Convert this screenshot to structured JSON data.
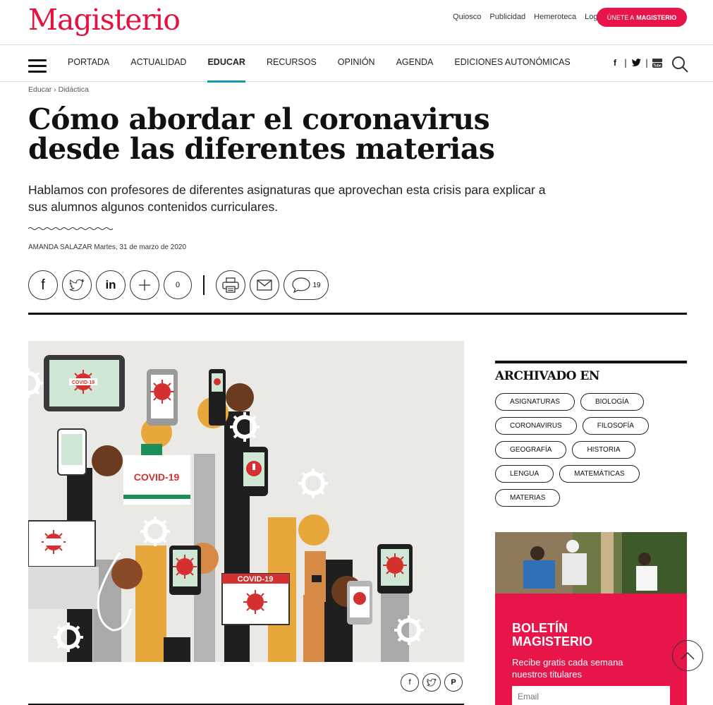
{
  "header": {
    "logo": "Magisterio",
    "links": [
      "Quiosco",
      "Publicidad",
      "Hemeroteca",
      "Login"
    ],
    "join_prefix": "ÚNETE A",
    "join_brand": "MAGISTERIO"
  },
  "nav": {
    "items": [
      "PORTADA",
      "ACTUALIDAD",
      "EDUCAR",
      "RECURSOS",
      "OPINIÓN",
      "AGENDA",
      "EDICIONES AUTONÓMICAS"
    ],
    "active": "EDUCAR"
  },
  "breadcrumb": "Educar › Didáctica",
  "article": {
    "title": "Cómo abordar el coronavirus desde las diferentes materias",
    "subtitle": "Hablamos con profesores de diferentes asignaturas que aprovechan esta crisis para explicar a sus alumnos algunos contenidos curriculares.",
    "author": "AMANDA SALAZAR",
    "date": "Martes, 31 de marzo de 2020",
    "share_count": "0",
    "comment_count": "19"
  },
  "hero_image": {
    "label_a": "COVID-19",
    "label_b": "COVID-19",
    "label_c": "COVID-19"
  },
  "sidebar": {
    "archived_title": "ARCHIVADO EN",
    "tags": [
      "ASIGNATURAS",
      "BIOLOGÍA",
      "CORONAVIRUS",
      "FILOSOFÍA",
      "GEOGRAFÍA",
      "HISTORIA",
      "LENGUA",
      "MATEMÁTICAS",
      "MATERIAS"
    ]
  },
  "newsletter": {
    "title_line1": "BOLETÍN",
    "title_line2": "MAGISTERIO",
    "subtitle": "Recibe gratis cada semana nuestros titulares",
    "email_placeholder": "Email"
  },
  "colors": {
    "brand": "#e5123d",
    "active_underline": "#1a9ab0",
    "virus_red": "#d43030"
  }
}
